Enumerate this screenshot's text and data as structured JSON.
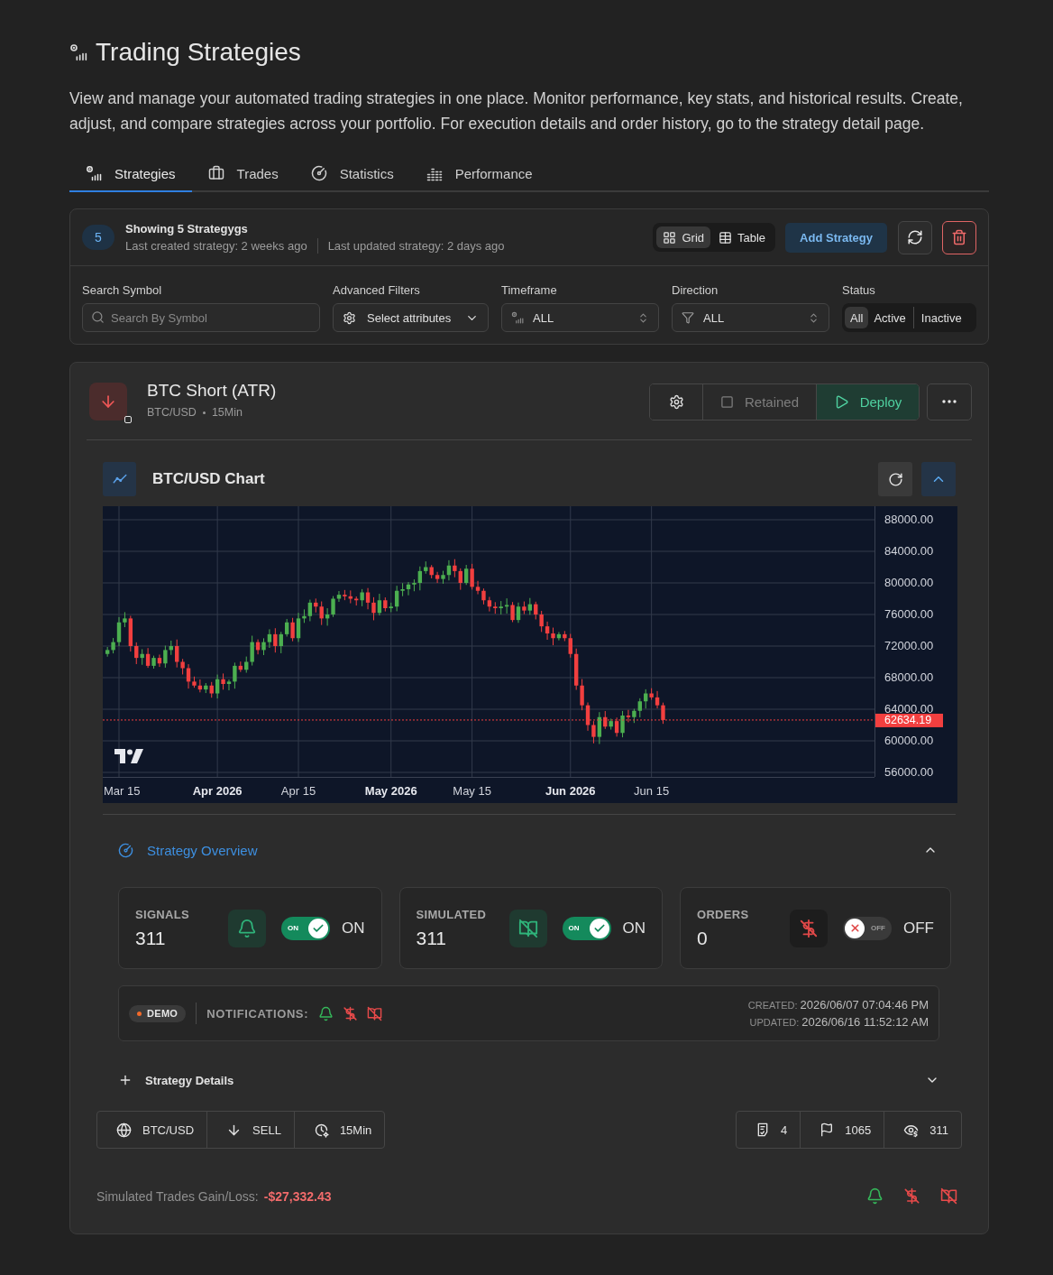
{
  "header": {
    "title": "Trading Strategies",
    "description": "View and manage your automated trading strategies in one place. Monitor performance, key stats, and historical results. Create, adjust, and compare strategies across your portfolio. For execution details and order history, go to the strategy detail page."
  },
  "tabs": [
    {
      "kind": "strategies",
      "label": "Strategies",
      "selected": true
    },
    {
      "kind": "trades",
      "label": "Trades",
      "selected": false
    },
    {
      "kind": "statistics",
      "label": "Statistics",
      "selected": false
    },
    {
      "kind": "performance",
      "label": "Performance",
      "selected": false
    }
  ],
  "summary": {
    "count": "5",
    "heading": "Showing 5 Strategygs",
    "last_created": "Last created strategy: 2 weeks ago",
    "last_updated": "Last updated strategy: 2 days ago"
  },
  "view_modes": [
    {
      "kind": "grid",
      "label": "Grid",
      "selected": true
    },
    {
      "kind": "table",
      "label": "Table",
      "selected": false
    }
  ],
  "add_button": "Add Strategy",
  "filters": {
    "search": {
      "label": "Search Symbol",
      "placeholder": "Search By Symbol"
    },
    "advanced": {
      "label": "Advanced Filters",
      "value": "Select attributes"
    },
    "timeframe": {
      "label": "Timeframe",
      "value": "ALL"
    },
    "direction": {
      "label": "Direction",
      "value": "ALL"
    },
    "status": {
      "label": "Status",
      "options": [
        {
          "label": "All",
          "selected": true
        },
        {
          "label": "Active",
          "selected": false
        },
        {
          "label": "Inactive",
          "selected": false
        }
      ]
    }
  },
  "strategy": {
    "name": "BTC Short (ATR)",
    "symbol": "BTC/USD",
    "timeframe": "15Min",
    "retained": {
      "label": "Retained",
      "checked": false
    },
    "deploy": "Deploy",
    "chart": {
      "title": "BTC/USD Chart",
      "expanded": true,
      "price_labels": [
        "88000.00",
        "84000.00",
        "80000.00",
        "76000.00",
        "72000.00",
        "68000.00",
        "64000.00",
        "60000.00",
        "56000.00"
      ],
      "date_labels": [
        {
          "label": "Mar 15",
          "major": false
        },
        {
          "label": "Apr 2026",
          "major": true
        },
        {
          "label": "Apr 15",
          "major": false
        },
        {
          "label": "May 2026",
          "major": true
        },
        {
          "label": "May 15",
          "major": false
        },
        {
          "label": "Jun 2026",
          "major": true
        },
        {
          "label": "Jun 15",
          "major": false
        }
      ],
      "last_price": "62634.19"
    },
    "overview": {
      "title": "Strategy Overview",
      "expanded": true,
      "stats": [
        {
          "kind": "signals",
          "label": "SIGNALS",
          "value": "311",
          "on": true,
          "switch_text": "ON",
          "state": "ON"
        },
        {
          "kind": "simulated",
          "label": "SIMULATED",
          "value": "311",
          "on": true,
          "switch_text": "ON",
          "state": "ON"
        },
        {
          "kind": "orders",
          "label": "ORDERS",
          "value": "0",
          "on": false,
          "switch_text": "OFF",
          "state": "OFF"
        }
      ],
      "mode": "DEMO",
      "notifications": {
        "label": "NOTIFICATIONS:",
        "items": [
          {
            "kind": "signals",
            "on": true
          },
          {
            "kind": "orders",
            "on": false
          },
          {
            "kind": "simulated",
            "on": false
          }
        ]
      },
      "timestamps": [
        {
          "label": "CREATED:",
          "value": "2026/06/07 07:04:46 PM"
        },
        {
          "label": "UPDATED:",
          "value": "2026/06/16 11:52:12 AM"
        }
      ]
    },
    "details": {
      "title": "Strategy Details",
      "expanded": false
    },
    "tags": [
      {
        "kind": "symbol",
        "label": "BTC/USD"
      },
      {
        "kind": "side",
        "label": "SELL"
      },
      {
        "kind": "timeframe",
        "label": "15Min"
      }
    ],
    "counters": [
      {
        "kind": "rules",
        "label": "4"
      },
      {
        "kind": "flags",
        "label": "1065"
      },
      {
        "kind": "watchers",
        "label": "311"
      }
    ],
    "gain_loss": {
      "label": "Simulated Trades Gain/Loss:",
      "value": "-$27,332.43"
    },
    "alerts": [
      {
        "kind": "signals",
        "on": true
      },
      {
        "kind": "orders",
        "on": false
      },
      {
        "kind": "simulated",
        "on": false
      }
    ]
  }
}
